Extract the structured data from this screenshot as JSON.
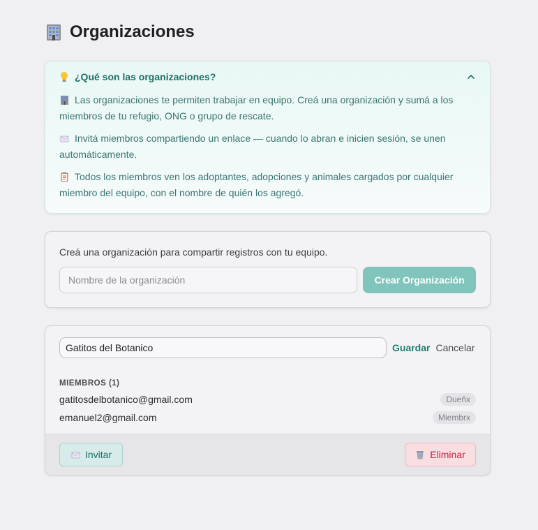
{
  "page": {
    "title": "Organizaciones"
  },
  "info": {
    "title": "¿Qué son las organizaciones?",
    "paragraphs": [
      "Las organizaciones te permiten trabajar en equipo. Creá una organización y sumá a los miembros de tu refugio, ONG o grupo de rescate.",
      "Invitá miembros compartiendo un enlace — cuando lo abran e inicien sesión, se unen automáticamente.",
      "Todos los miembros ven los adoptantes, adopciones y animales cargados por cualquier miembro del equipo, con el nombre de quién los agregó."
    ]
  },
  "create": {
    "description": "Creá una organización para compartir registros con tu equipo.",
    "input_placeholder": "Nombre de la organización",
    "input_value": "",
    "button_label": "Crear Organización"
  },
  "org": {
    "name_value": "Gatitos del Botanico",
    "save_label": "Guardar",
    "cancel_label": "Cancelar",
    "members_heading": "MIEMBROS (1)",
    "members": [
      {
        "email": "gatitosdelbotanico@gmail.com",
        "role": "Dueñx"
      },
      {
        "email": "emanuel2@gmail.com",
        "role": "Miembrx"
      }
    ],
    "invite_label": "Invitar",
    "delete_label": "Eliminar"
  },
  "colors": {
    "accent": "#1f7d71",
    "create_button": "#80c4bc",
    "danger": "#c32542",
    "background": "#f0eff1"
  },
  "icons": {
    "title": "office-building-icon",
    "info": "lightbulb-icon",
    "p1": "office-building-icon",
    "p2": "envelope-icon",
    "p3": "clipboard-icon",
    "collapse": "chevron-up-icon",
    "invite": "envelope-icon",
    "delete": "trash-icon"
  }
}
